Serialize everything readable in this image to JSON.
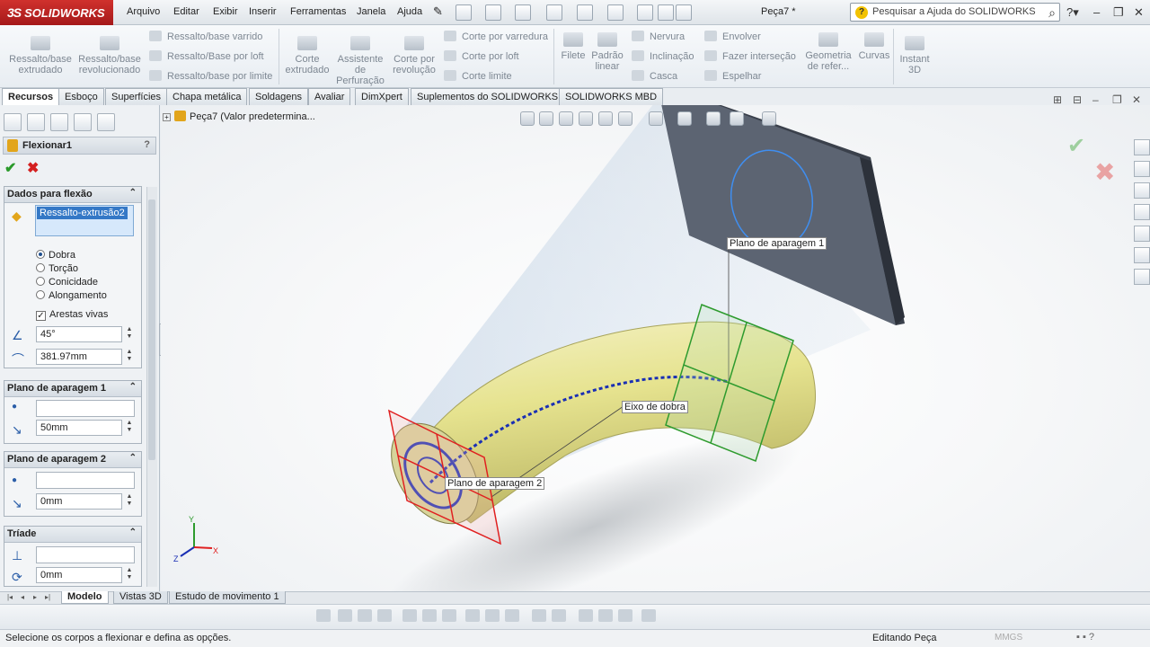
{
  "app": {
    "logo": "SOLIDWORKS",
    "logo_mark": "3S",
    "doc_title": "Peça7 *"
  },
  "menu": [
    "Arquivo",
    "Editar",
    "Exibir",
    "Inserir",
    "Ferramentas",
    "Janela",
    "Ajuda"
  ],
  "search": {
    "placeholder": "Pesquisar a Ajuda do SOLIDWORKS",
    "q_icon": "?"
  },
  "command_manager": {
    "big": [
      {
        "label": "Ressalto/base extrudado"
      },
      {
        "label": "Ressalto/base revolucionado"
      },
      {
        "label": "Corte extrudado"
      },
      {
        "label": "Assistente de Perfuração"
      },
      {
        "label": "Corte por revolução"
      },
      {
        "label": "Filete"
      },
      {
        "label": "Padrão linear"
      },
      {
        "label": "Geometria de refer..."
      },
      {
        "label": "Curvas"
      },
      {
        "label": "Instant 3D"
      }
    ],
    "small": [
      "Ressalto/base varrido",
      "Ressalto/Base por loft",
      "Ressalto/base por limite",
      "Corte por varredura",
      "Corte por loft",
      "Corte limite",
      "Nervura",
      "Inclinação",
      "Casca",
      "Envolver",
      "Fazer interseção",
      "Espelhar"
    ]
  },
  "tabs": [
    "Recursos",
    "Esboço",
    "Superfícies",
    "Chapa metálica",
    "Soldagens",
    "Avaliar",
    "DimXpert",
    "Suplementos do SOLIDWORKS",
    "SOLIDWORKS MBD"
  ],
  "property_manager": {
    "title": "Flexionar1",
    "help": "?",
    "ok": "✔",
    "cancel": "✖",
    "groups": {
      "flex_data": {
        "title": "Dados para flexão",
        "selected_body": "Ressalto-extrusão2",
        "options": [
          "Dobra",
          "Torção",
          "Conicidade",
          "Alongamento"
        ],
        "selected_option": "Dobra",
        "sharp_edges_label": "Arestas vivas",
        "sharp_edges_checked": true,
        "angle": "45°",
        "radius": "381.97mm"
      },
      "trim_plane_1": {
        "title": "Plano de aparagem 1",
        "distance": "50mm"
      },
      "trim_plane_2": {
        "title": "Plano de aparagem 2",
        "distance": "0mm"
      },
      "triad": {
        "title": "Tríade",
        "value": "0mm"
      }
    }
  },
  "feature_tree": {
    "root": "Peça7  (Valor predetermina..."
  },
  "viewport": {
    "labels": {
      "trim_plane_1": "Plano de aparagem 1",
      "bend_axis": "Eixo de dobra",
      "trim_plane_2": "Plano de aparagem 2"
    },
    "triad_axes": {
      "x": "X",
      "y": "Y",
      "z": "Z"
    },
    "colors": {
      "tube": "#e9e79a",
      "trim_plane_1": "#2e9b2e",
      "trim_plane_2": "#e02020",
      "bend_axis": "#1a2fb4",
      "plate": "#5c6472"
    }
  },
  "bottom_tabs": [
    "Modelo",
    "Vistas 3D",
    "Estudo de movimento 1"
  ],
  "status": {
    "message": "Selecione os corpos a flexionar e defina as opções.",
    "mode": "Editando Peça",
    "units": "MMGS"
  }
}
